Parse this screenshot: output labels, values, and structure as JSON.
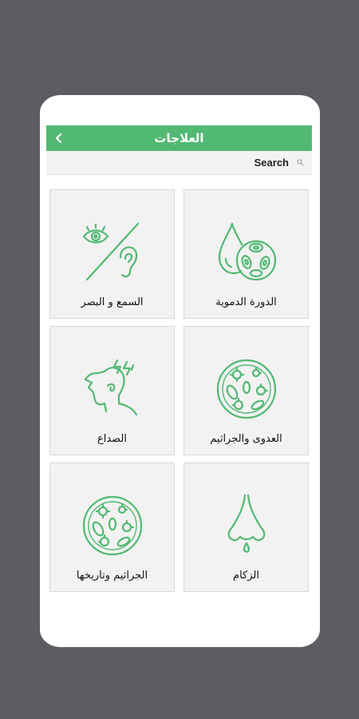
{
  "appbar": {
    "title": "العلاجات"
  },
  "search": {
    "placeholder": "Search"
  },
  "colors": {
    "accent": "#52b973",
    "background": "#5c5d61",
    "card": "#f2f2f2"
  },
  "cards": [
    {
      "label": "الدورة الدموية",
      "icon": "blood-drop-icon"
    },
    {
      "label": "السمع و البصر",
      "icon": "eye-ear-icon"
    },
    {
      "label": "العدوى والجراثيم",
      "icon": "germs-icon"
    },
    {
      "label": "الصداع",
      "icon": "headache-icon"
    },
    {
      "label": "الزكام",
      "icon": "nose-icon"
    },
    {
      "label": "الجراثيم وتاريخها",
      "icon": "germs-history-icon"
    }
  ]
}
